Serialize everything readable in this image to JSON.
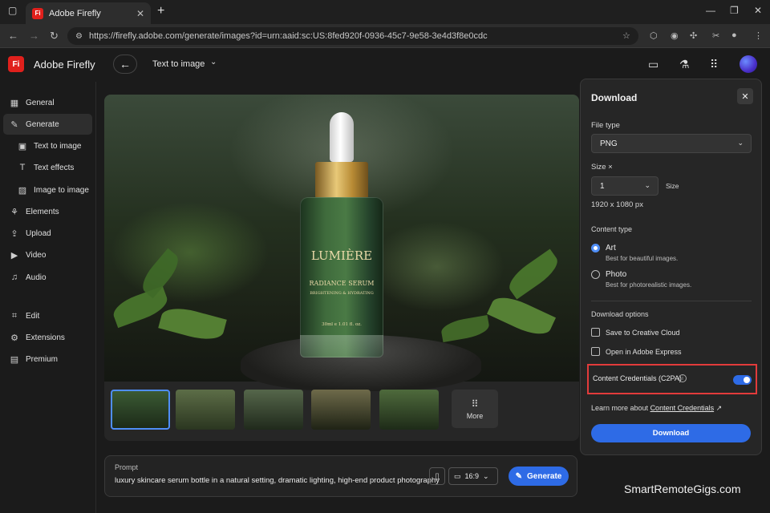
{
  "browser": {
    "tab_title": "Adobe Firefly",
    "tab_favicon": "Fi",
    "url": "https://firefly.adobe.com/generate/images?id=urn:aaid:sc:US:8fed920f-0936-45c7-9e58-3e4d3f8e0cdc"
  },
  "app": {
    "logo": "Fi",
    "name": "Adobe Firefly",
    "mode": "Text to image"
  },
  "sidebar": {
    "items": [
      {
        "label": "General",
        "icon": "general-icon"
      },
      {
        "label": "Generate",
        "icon": "generate-icon"
      },
      {
        "label": "Text to image",
        "icon": "text-to-image-icon"
      },
      {
        "label": "Text effects",
        "icon": "text-effects-icon"
      },
      {
        "label": "Image to image",
        "icon": "image-to-image-icon"
      },
      {
        "label": "Elements",
        "icon": "elements-icon"
      },
      {
        "label": "Upload",
        "icon": "upload-icon"
      },
      {
        "label": "Video",
        "icon": "video-icon"
      },
      {
        "label": "Audio",
        "icon": "audio-icon"
      },
      {
        "label": "Edit",
        "icon": "edit-icon"
      },
      {
        "label": "Extensions",
        "icon": "extensions-icon"
      },
      {
        "label": "Premium",
        "icon": "premium-icon"
      }
    ]
  },
  "canvas": {
    "brand": "LUMIÈRE",
    "product": "RADIANCE SERUM",
    "tagline": "BRIGHTENING & HYDRATING",
    "volume": "30ml e 1.01 fl. oz.",
    "more_label": "More"
  },
  "prompt": {
    "label": "Prompt",
    "text": "luxury skincare serum bottle in a natural setting, dramatic lighting, high-end product photography",
    "ratio": "16:9",
    "generate_label": "Generate"
  },
  "download_panel": {
    "title": "Download",
    "file_type_label": "File type",
    "file_type_value": "PNG",
    "size_label": "Size ×",
    "size_value": "1",
    "size_suffix": "Size",
    "dimensions": "1920 x 1080 px",
    "content_type_label": "Content type",
    "options": [
      {
        "title": "Art",
        "sub": "Best for beautiful images.",
        "selected": true
      },
      {
        "title": "Photo",
        "sub": "Best for photorealistic images.",
        "selected": false
      }
    ],
    "download_options_label": "Download options",
    "checkboxes": [
      "Save to Creative Cloud",
      "Open in Adobe Express"
    ],
    "credentials_label": "Content Credentials (C2PA)",
    "credentials_on": true,
    "learn_prefix": "Learn more about",
    "learn_link": "Content Credentials",
    "download_button": "Download"
  },
  "watermark": "SmartRemoteGigs.com",
  "colors": {
    "accent": "#2e6be6",
    "highlight": "#e23b3b",
    "firefly_red": "#e0201c"
  }
}
